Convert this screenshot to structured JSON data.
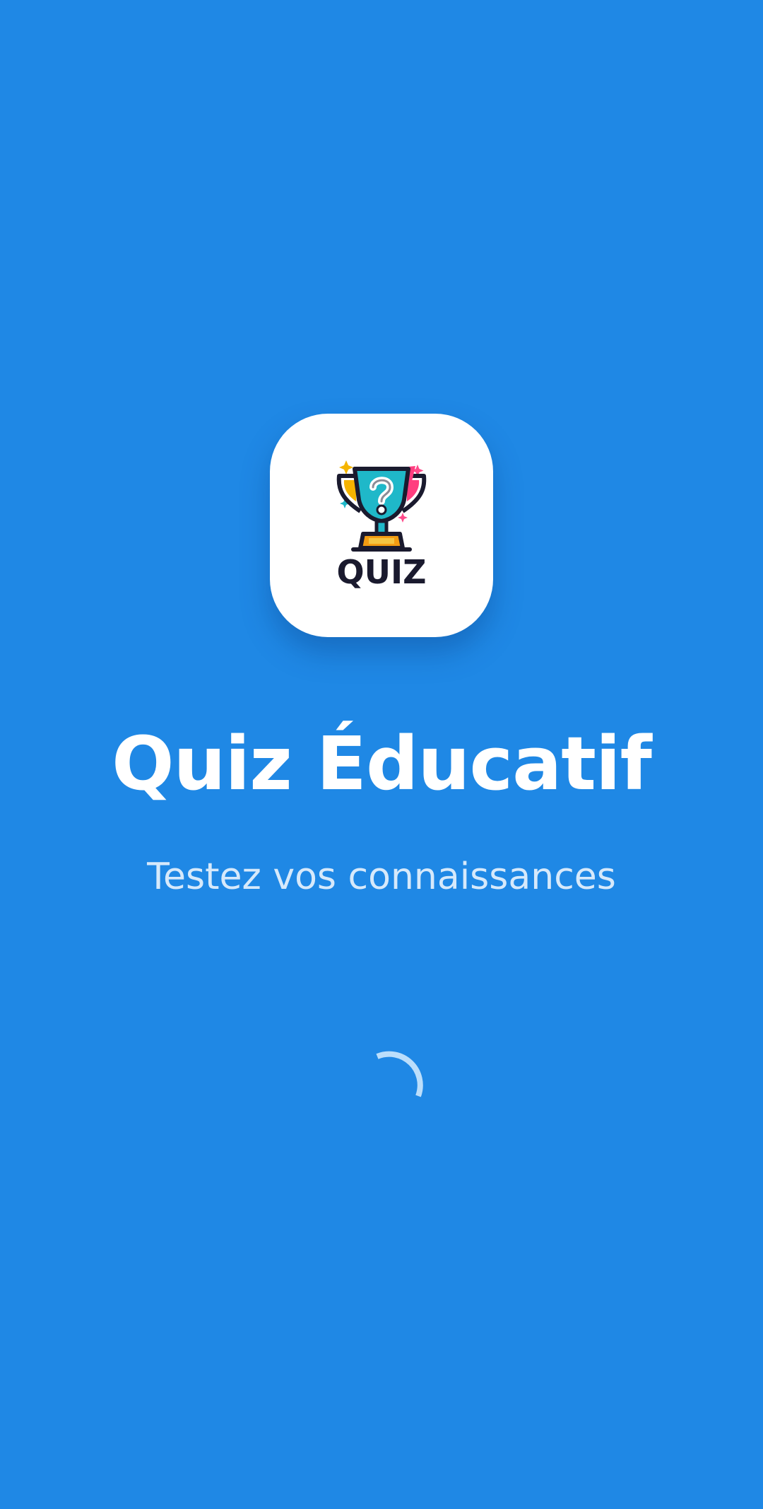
{
  "splash": {
    "logo_text": "QUIZ",
    "title": "Quiz Éducatif",
    "subtitle": "Testez vos connaissances"
  },
  "colors": {
    "background": "#1f88e5",
    "card": "#ffffff",
    "title": "#ffffff",
    "spinner": "#bbdefb"
  },
  "icons": {
    "logo": "trophy-question-icon",
    "loading": "loading-spinner"
  }
}
